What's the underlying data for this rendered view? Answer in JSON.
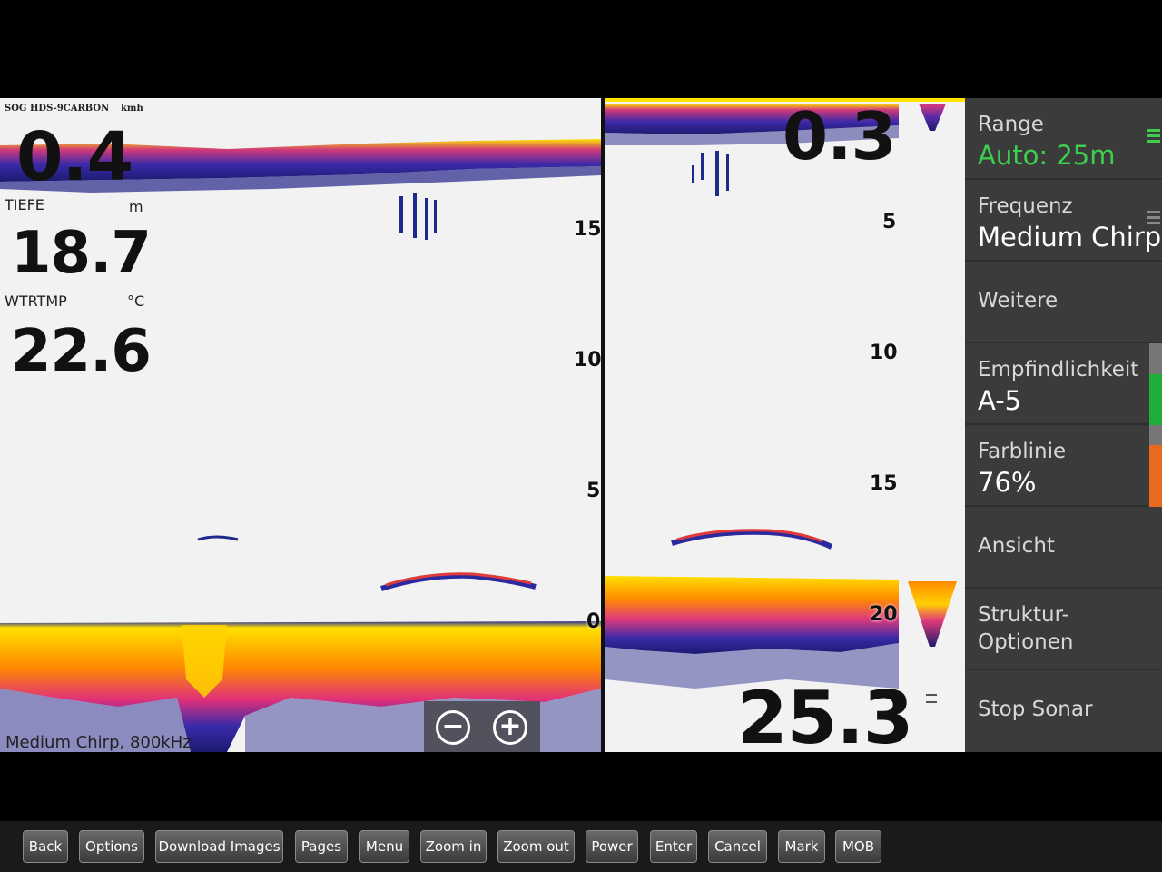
{
  "left_pane": {
    "sog_label": "SOG HDS-9CARBON",
    "sog_unit": "kmh",
    "sog_value": "0.4",
    "depth_label": "TIEFE",
    "depth_unit": "m",
    "depth_value": "18.7",
    "water_temp_label": "WTRTMP",
    "water_temp_unit": "°C",
    "water_temp_value": "22.6",
    "scale_labels": [
      "15",
      "10",
      "5",
      "0"
    ],
    "frequency_label": "Medium Chirp, 800kHz"
  },
  "right_pane": {
    "top_value": "0.3",
    "scale_labels": [
      "5",
      "10",
      "15",
      "20"
    ],
    "bottom_value": "25.3"
  },
  "zoom": {
    "zoom_out_symbol": "−",
    "zoom_in_symbol": "+"
  },
  "side_menu": {
    "items": [
      {
        "label": "Range",
        "value": "Auto: 25m",
        "value_color": "#3ccf4e"
      },
      {
        "label": "Frequenz",
        "value": "Medium Chirp"
      },
      {
        "label": "Weitere",
        "value": ""
      },
      {
        "label": "Empfindlichkeit",
        "value": "A-5"
      },
      {
        "label": "Farblinie",
        "value": "76%"
      },
      {
        "label": "Ansicht",
        "value": ""
      },
      {
        "label": "Struktur-",
        "value": "Optionen"
      },
      {
        "label": "Stop Sonar",
        "value": ""
      }
    ],
    "indicator_colors": {
      "sensitivity": "#1fae3a",
      "colorline": "#e86a1e",
      "range_grip": "#3ccf4e"
    }
  },
  "bottom_bar": {
    "buttons": [
      "Back",
      "Options",
      "Download Images",
      "Pages",
      "Menu",
      "Zoom in",
      "Zoom out",
      "Power",
      "Enter",
      "Cancel",
      "Mark",
      "MOB"
    ]
  }
}
